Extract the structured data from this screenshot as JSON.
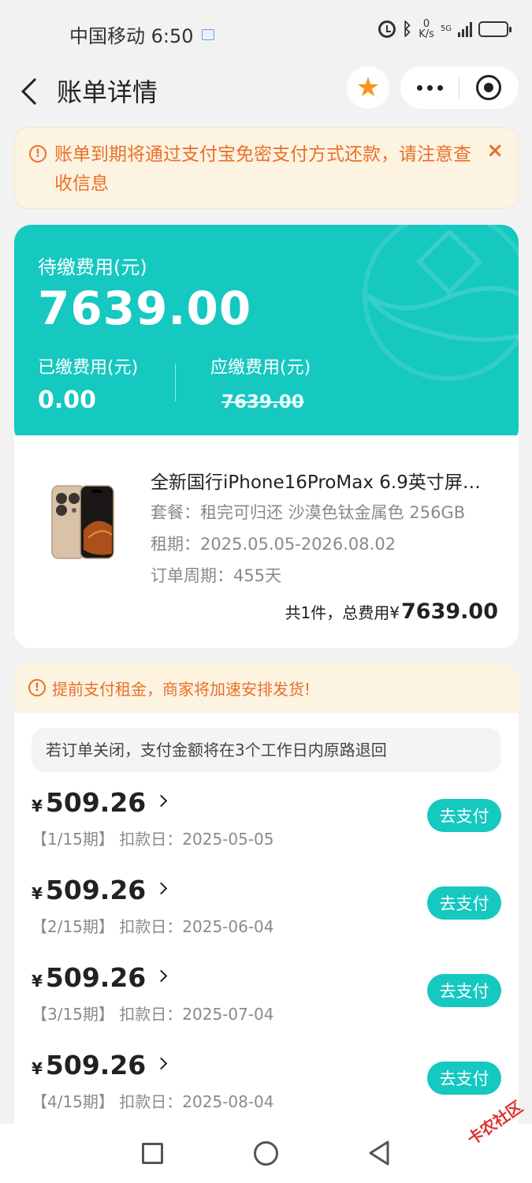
{
  "status_bar": {
    "carrier_time": "中国移动 6:50",
    "speed_value": "0",
    "speed_unit": "K/s",
    "network": "5G"
  },
  "nav": {
    "title": "账单详情",
    "icons": [
      "back-icon",
      "star-icon",
      "more-icon",
      "target-icon"
    ]
  },
  "notice": {
    "text": "账单到期将通过支付宝免密支付方式还款，请注意查收信息",
    "close": "×"
  },
  "summary": {
    "due_label": "待缴费用(元)",
    "due_amount": "7639.00",
    "paid_label": "已缴费用(元)",
    "paid_amount": "0.00",
    "payable_label": "应缴费用(元)",
    "payable_amount": "7639.00"
  },
  "product": {
    "name": "全新国行iPhone16ProMax 6.9英寸屏…",
    "plan_line": "套餐：租完可归还 沙漠色钛金属色 256GB",
    "term_line": "租期：2025.05.05-2026.08.02",
    "cycle_line": "订单周期：455天",
    "total_prefix": "共1件，总费用¥",
    "total_amount": "7639.00"
  },
  "plan": {
    "tip": "提前支付租金，商家将加速安排发货!",
    "refund_note": "若订单关闭，支付金额将在3个工作日内原路退回",
    "currency": "¥",
    "pay_label": "去支付",
    "installments": [
      {
        "amount": "509.26",
        "meta": "【1/15期】 扣款日：2025-05-05"
      },
      {
        "amount": "509.26",
        "meta": "【2/15期】 扣款日：2025-06-04"
      },
      {
        "amount": "509.26",
        "meta": "【3/15期】 扣款日：2025-07-04"
      },
      {
        "amount": "509.26",
        "meta": "【4/15期】 扣款日：2025-08-04"
      }
    ]
  },
  "watermark": "卡农社区",
  "colors": {
    "accent": "#15c8c0",
    "warning": "#e8702a",
    "warning_bg": "#fdf3e1",
    "star": "#f7931e"
  }
}
